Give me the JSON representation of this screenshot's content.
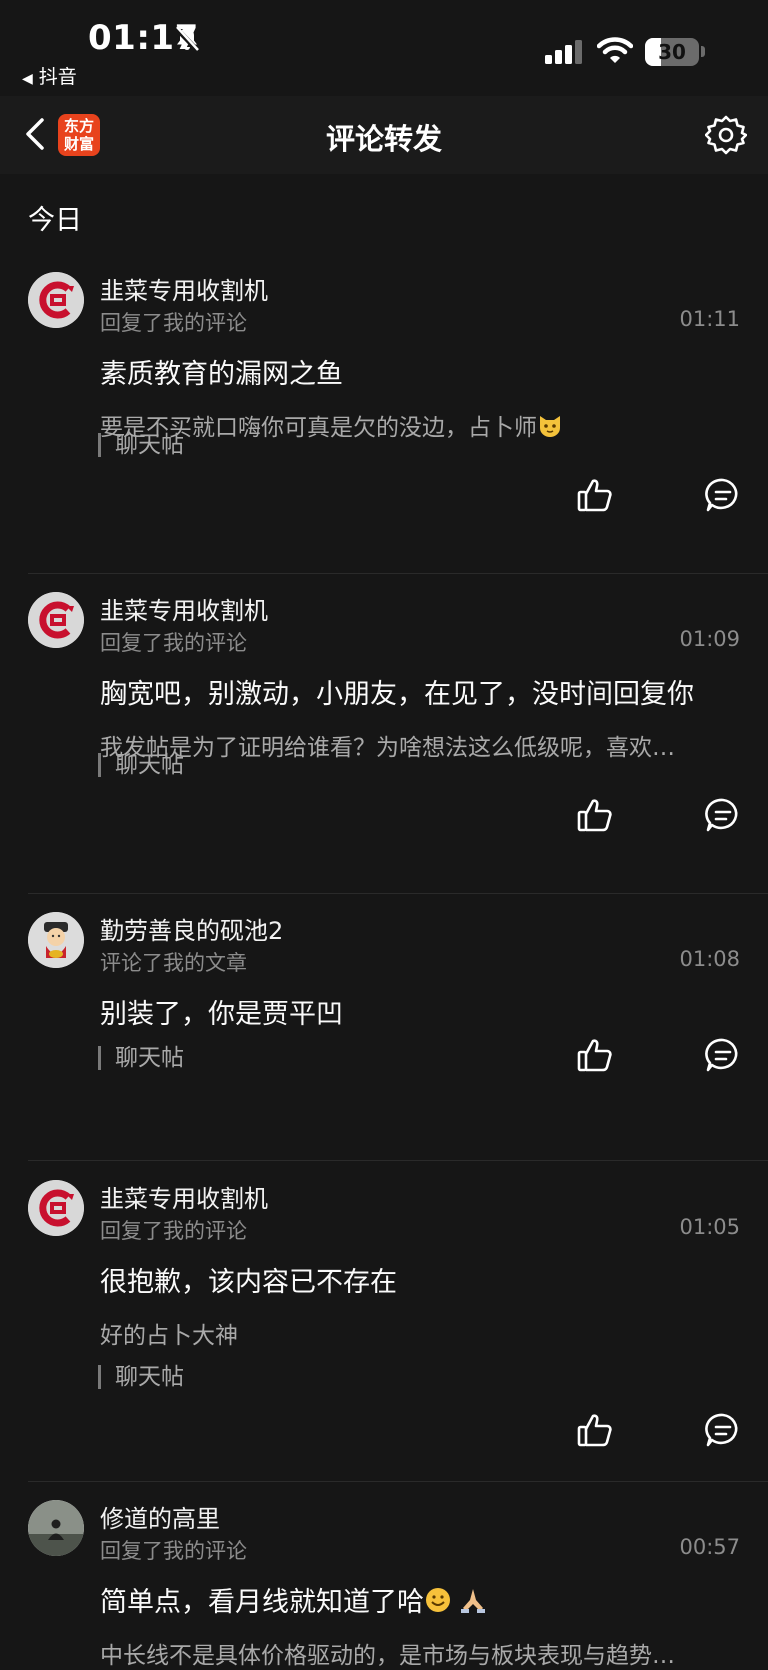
{
  "status_bar": {
    "time": "01:17",
    "back_app": "抖音",
    "battery": "30",
    "battery_level_percent": 30
  },
  "nav": {
    "logo_line1": "东方",
    "logo_line2": "财富",
    "title": "评论转发"
  },
  "section": {
    "title": "今日"
  },
  "items": [
    {
      "username": "韭菜专用收割机",
      "action": "回复了我的评论",
      "time": "01:11",
      "headline": "素质教育的漏网之鱼",
      "quote": "要是不买就口嗨你可真是欠的没边，占卜师",
      "source": "聊天帖",
      "avatar": "brand-logo-avatar"
    },
    {
      "username": "韭菜专用收割机",
      "action": "回复了我的评论",
      "time": "01:09",
      "headline": "胸宽吧，别激动，小朋友，在见了，没时间回复你",
      "quote": "我发帖是为了证明给谁看？为啥想法这么低级呢，喜欢…",
      "source": "聊天帖",
      "avatar": "brand-logo-avatar"
    },
    {
      "username": "勤劳善良的砚池2",
      "action": "评论了我的文章",
      "time": "01:08",
      "headline": "别装了，你是贾平凹",
      "quote": "",
      "source": "聊天帖",
      "avatar": "fortune-god-avatar"
    },
    {
      "username": "韭菜专用收割机",
      "action": "回复了我的评论",
      "time": "01:05",
      "headline": "很抱歉，该内容已不存在",
      "quote": "好的占卜大神",
      "source": "聊天帖",
      "avatar": "brand-logo-avatar"
    },
    {
      "username": "修道的高里",
      "action": "回复了我的评论",
      "time": "00:57",
      "headline": "简单点，看月线就知道了哈",
      "quote": "中长线不是具体价格驱动的，是市场与板块表现与趋势…",
      "source": "",
      "avatar": "meditating-figure-avatar"
    }
  ],
  "colors": {
    "background": "#161616",
    "accent": "#e8431d",
    "avatar_logo_red": "#c8102e"
  }
}
